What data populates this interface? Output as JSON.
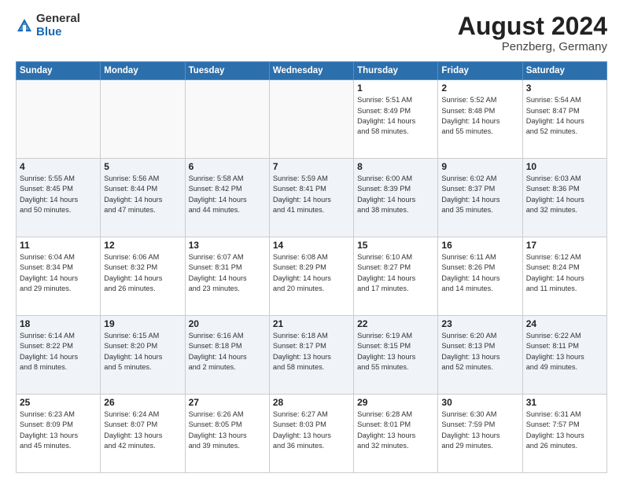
{
  "logo": {
    "general": "General",
    "blue": "Blue"
  },
  "header": {
    "month_year": "August 2024",
    "location": "Penzberg, Germany"
  },
  "weekdays": [
    "Sunday",
    "Monday",
    "Tuesday",
    "Wednesday",
    "Thursday",
    "Friday",
    "Saturday"
  ],
  "weeks": [
    [
      {
        "day": "",
        "info": ""
      },
      {
        "day": "",
        "info": ""
      },
      {
        "day": "",
        "info": ""
      },
      {
        "day": "",
        "info": ""
      },
      {
        "day": "1",
        "info": "Sunrise: 5:51 AM\nSunset: 8:49 PM\nDaylight: 14 hours\nand 58 minutes."
      },
      {
        "day": "2",
        "info": "Sunrise: 5:52 AM\nSunset: 8:48 PM\nDaylight: 14 hours\nand 55 minutes."
      },
      {
        "day": "3",
        "info": "Sunrise: 5:54 AM\nSunset: 8:47 PM\nDaylight: 14 hours\nand 52 minutes."
      }
    ],
    [
      {
        "day": "4",
        "info": "Sunrise: 5:55 AM\nSunset: 8:45 PM\nDaylight: 14 hours\nand 50 minutes."
      },
      {
        "day": "5",
        "info": "Sunrise: 5:56 AM\nSunset: 8:44 PM\nDaylight: 14 hours\nand 47 minutes."
      },
      {
        "day": "6",
        "info": "Sunrise: 5:58 AM\nSunset: 8:42 PM\nDaylight: 14 hours\nand 44 minutes."
      },
      {
        "day": "7",
        "info": "Sunrise: 5:59 AM\nSunset: 8:41 PM\nDaylight: 14 hours\nand 41 minutes."
      },
      {
        "day": "8",
        "info": "Sunrise: 6:00 AM\nSunset: 8:39 PM\nDaylight: 14 hours\nand 38 minutes."
      },
      {
        "day": "9",
        "info": "Sunrise: 6:02 AM\nSunset: 8:37 PM\nDaylight: 14 hours\nand 35 minutes."
      },
      {
        "day": "10",
        "info": "Sunrise: 6:03 AM\nSunset: 8:36 PM\nDaylight: 14 hours\nand 32 minutes."
      }
    ],
    [
      {
        "day": "11",
        "info": "Sunrise: 6:04 AM\nSunset: 8:34 PM\nDaylight: 14 hours\nand 29 minutes."
      },
      {
        "day": "12",
        "info": "Sunrise: 6:06 AM\nSunset: 8:32 PM\nDaylight: 14 hours\nand 26 minutes."
      },
      {
        "day": "13",
        "info": "Sunrise: 6:07 AM\nSunset: 8:31 PM\nDaylight: 14 hours\nand 23 minutes."
      },
      {
        "day": "14",
        "info": "Sunrise: 6:08 AM\nSunset: 8:29 PM\nDaylight: 14 hours\nand 20 minutes."
      },
      {
        "day": "15",
        "info": "Sunrise: 6:10 AM\nSunset: 8:27 PM\nDaylight: 14 hours\nand 17 minutes."
      },
      {
        "day": "16",
        "info": "Sunrise: 6:11 AM\nSunset: 8:26 PM\nDaylight: 14 hours\nand 14 minutes."
      },
      {
        "day": "17",
        "info": "Sunrise: 6:12 AM\nSunset: 8:24 PM\nDaylight: 14 hours\nand 11 minutes."
      }
    ],
    [
      {
        "day": "18",
        "info": "Sunrise: 6:14 AM\nSunset: 8:22 PM\nDaylight: 14 hours\nand 8 minutes."
      },
      {
        "day": "19",
        "info": "Sunrise: 6:15 AM\nSunset: 8:20 PM\nDaylight: 14 hours\nand 5 minutes."
      },
      {
        "day": "20",
        "info": "Sunrise: 6:16 AM\nSunset: 8:18 PM\nDaylight: 14 hours\nand 2 minutes."
      },
      {
        "day": "21",
        "info": "Sunrise: 6:18 AM\nSunset: 8:17 PM\nDaylight: 13 hours\nand 58 minutes."
      },
      {
        "day": "22",
        "info": "Sunrise: 6:19 AM\nSunset: 8:15 PM\nDaylight: 13 hours\nand 55 minutes."
      },
      {
        "day": "23",
        "info": "Sunrise: 6:20 AM\nSunset: 8:13 PM\nDaylight: 13 hours\nand 52 minutes."
      },
      {
        "day": "24",
        "info": "Sunrise: 6:22 AM\nSunset: 8:11 PM\nDaylight: 13 hours\nand 49 minutes."
      }
    ],
    [
      {
        "day": "25",
        "info": "Sunrise: 6:23 AM\nSunset: 8:09 PM\nDaylight: 13 hours\nand 45 minutes."
      },
      {
        "day": "26",
        "info": "Sunrise: 6:24 AM\nSunset: 8:07 PM\nDaylight: 13 hours\nand 42 minutes."
      },
      {
        "day": "27",
        "info": "Sunrise: 6:26 AM\nSunset: 8:05 PM\nDaylight: 13 hours\nand 39 minutes."
      },
      {
        "day": "28",
        "info": "Sunrise: 6:27 AM\nSunset: 8:03 PM\nDaylight: 13 hours\nand 36 minutes."
      },
      {
        "day": "29",
        "info": "Sunrise: 6:28 AM\nSunset: 8:01 PM\nDaylight: 13 hours\nand 32 minutes."
      },
      {
        "day": "30",
        "info": "Sunrise: 6:30 AM\nSunset: 7:59 PM\nDaylight: 13 hours\nand 29 minutes."
      },
      {
        "day": "31",
        "info": "Sunrise: 6:31 AM\nSunset: 7:57 PM\nDaylight: 13 hours\nand 26 minutes."
      }
    ]
  ]
}
